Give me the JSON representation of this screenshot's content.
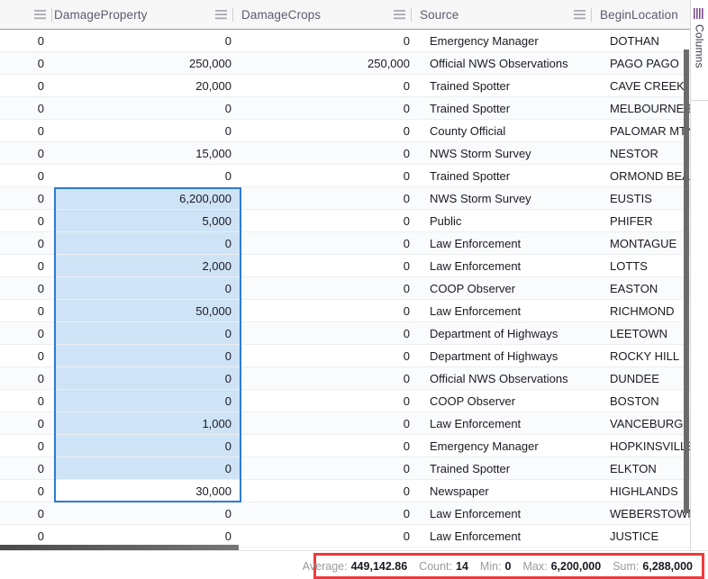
{
  "grid": {
    "columns": [
      {
        "key": "DamageProperty_left",
        "label": "DamageProperty",
        "align": "num",
        "menu_icon": "hamburger-menu-icon"
      },
      {
        "key": "DamageCrops",
        "label": "DamageCrops",
        "align": "num",
        "menu_icon": "hamburger-menu-icon"
      },
      {
        "key": "Source",
        "label": "Source",
        "align": "txt",
        "menu_icon": "hamburger-menu-icon"
      },
      {
        "key": "BeginLocation",
        "label": "BeginLocation",
        "align": "txt",
        "menu_icon": "hamburger-menu-icon"
      }
    ],
    "rows": [
      {
        "c0": "0",
        "c1": "0",
        "c2": "0",
        "c3": "Emergency Manager",
        "c4": "DOTHAN"
      },
      {
        "c0": "0",
        "c1": "250,000",
        "c2": "250,000",
        "c3": "Official NWS Observations",
        "c4": "PAGO PAGO"
      },
      {
        "c0": "0",
        "c1": "20,000",
        "c2": "0",
        "c3": "Trained Spotter",
        "c4": "CAVE CREEK"
      },
      {
        "c0": "0",
        "c1": "0",
        "c2": "0",
        "c3": "Trained Spotter",
        "c4": "MELBOURNE BE"
      },
      {
        "c0": "0",
        "c1": "0",
        "c2": "0",
        "c3": "County Official",
        "c4": "PALOMAR MTN"
      },
      {
        "c0": "0",
        "c1": "15,000",
        "c2": "0",
        "c3": "NWS Storm Survey",
        "c4": "NESTOR"
      },
      {
        "c0": "0",
        "c1": "0",
        "c2": "0",
        "c3": "Trained Spotter",
        "c4": "ORMOND BEACH"
      },
      {
        "c0": "0",
        "c1": "6,200,000",
        "c2": "0",
        "c3": "NWS Storm Survey",
        "c4": "EUSTIS"
      },
      {
        "c0": "0",
        "c1": "5,000",
        "c2": "0",
        "c3": "Public",
        "c4": "PHIFER"
      },
      {
        "c0": "0",
        "c1": "0",
        "c2": "0",
        "c3": "Law Enforcement",
        "c4": "MONTAGUE"
      },
      {
        "c0": "0",
        "c1": "2,000",
        "c2": "0",
        "c3": "Law Enforcement",
        "c4": "LOTTS"
      },
      {
        "c0": "0",
        "c1": "0",
        "c2": "0",
        "c3": "COOP Observer",
        "c4": "EASTON"
      },
      {
        "c0": "0",
        "c1": "50,000",
        "c2": "0",
        "c3": "Law Enforcement",
        "c4": "RICHMOND"
      },
      {
        "c0": "0",
        "c1": "0",
        "c2": "0",
        "c3": "Department of Highways",
        "c4": "LEETOWN"
      },
      {
        "c0": "0",
        "c1": "0",
        "c2": "0",
        "c3": "Department of Highways",
        "c4": "ROCKY HILL"
      },
      {
        "c0": "0",
        "c1": "0",
        "c2": "0",
        "c3": "Official NWS Observations",
        "c4": "DUNDEE"
      },
      {
        "c0": "0",
        "c1": "0",
        "c2": "0",
        "c3": "COOP Observer",
        "c4": "BOSTON"
      },
      {
        "c0": "0",
        "c1": "1,000",
        "c2": "0",
        "c3": "Law Enforcement",
        "c4": "VANCEBURG"
      },
      {
        "c0": "0",
        "c1": "0",
        "c2": "0",
        "c3": "Emergency Manager",
        "c4": "HOPKINSVILLE A"
      },
      {
        "c0": "0",
        "c1": "0",
        "c2": "0",
        "c3": "Trained Spotter",
        "c4": "ELKTON"
      },
      {
        "c0": "0",
        "c1": "30,000",
        "c2": "0",
        "c3": "Newspaper",
        "c4": "HIGHLANDS"
      },
      {
        "c0": "0",
        "c1": "0",
        "c2": "0",
        "c3": "Law Enforcement",
        "c4": "WEBERSTOWN"
      },
      {
        "c0": "0",
        "c1": "0",
        "c2": "0",
        "c3": "Law Enforcement",
        "c4": "JUSTICE"
      }
    ],
    "selection": {
      "column": "c1",
      "first_row_index": 7,
      "last_row_index": 20,
      "active_row_index": 20,
      "fill_color": "#cee3f6",
      "border_color": "#2b7cd3"
    }
  },
  "side_panel": {
    "tab_label": "Columns",
    "tab_icon": "columns-grip-icon"
  },
  "status_bar": {
    "highlight_color": "#f4393c",
    "aggregates": [
      {
        "label": "Average:",
        "value": "449,142.86"
      },
      {
        "label": "Count:",
        "value": "14"
      },
      {
        "label": "Min:",
        "value": "0"
      },
      {
        "label": "Max:",
        "value": "6,200,000"
      },
      {
        "label": "Sum:",
        "value": "6,288,000"
      }
    ]
  }
}
